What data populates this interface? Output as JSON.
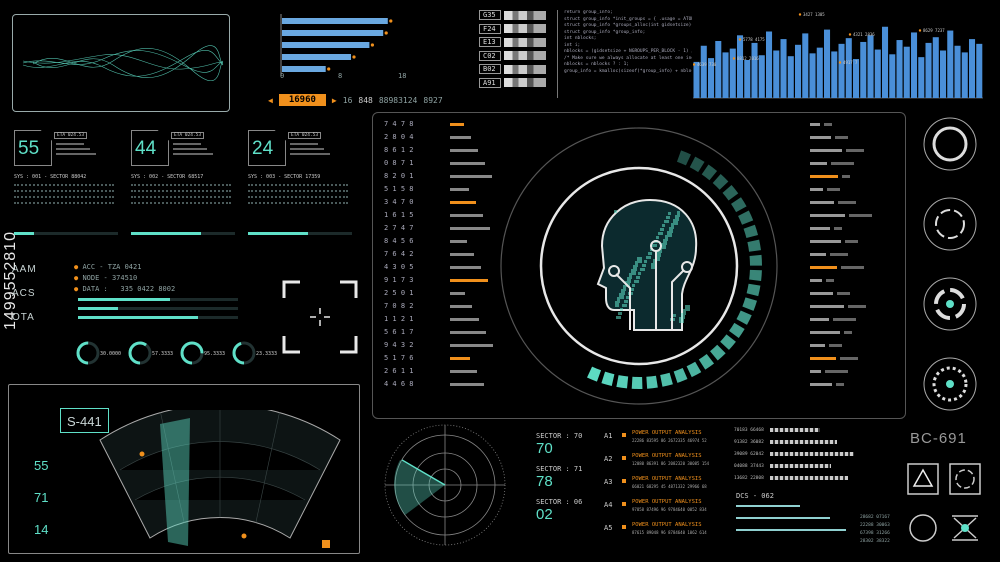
{
  "accent": "#5fe0c8",
  "orange": "#f0901c",
  "watermark": "1499552810",
  "top_counter": {
    "value": "16960",
    "rest": [
      "16",
      "848",
      "88983124",
      "8927"
    ]
  },
  "gauges": [
    {
      "value": "55",
      "tag": "ETA 024.53"
    },
    {
      "value": "44",
      "tag": "ETA 024.53"
    },
    {
      "value": "24",
      "tag": "ETA 024.53"
    }
  ],
  "sys_headers": [
    "SYS : 001 - SECTOR 88042",
    "SYS : 002 - SECTOR 68517",
    "SYS : 003 - SECTOR 17359"
  ],
  "side_labels": [
    "AAM",
    "ACS",
    "OTA"
  ],
  "info_lines": [
    "ACC - TZA 0421",
    "NODE - 374510",
    "DATA :",
    "335 0422 8002"
  ],
  "ring_values": [
    "30.0000",
    "57.3333",
    "95.3333",
    "23.3333"
  ],
  "radar_label": "S-441",
  "radar_side_numbers": [
    "55",
    "71",
    "14"
  ],
  "hbar_chart": {
    "values": [
      92,
      88,
      76,
      60,
      38
    ],
    "axis": [
      "0",
      "8",
      "18"
    ]
  },
  "code_tags": [
    "G35",
    "F24",
    "E13",
    "C02",
    "B02",
    "A91"
  ],
  "code_lines": [
    "return group_info;",
    "struct group_info *init_groups = { .usage = ATOMIC_INIT(2) };",
    "struct group_info *groups_alloc(int gidsetsize){",
    "  struct group_info *group_info;",
    "  int nblocks;",
    "  int i;",
    "nblocks = (gidsetsize + NGROUPS_PER_BLOCK - 1) / NGR",
    "/* Make sure we always allocate at least one indirect block",
    "nblocks = nblocks ? : 1;",
    "group_info = kmalloc(sizeof(*group_info) + nblocks*sizeof("
  ],
  "top_chart": {
    "values": [
      38,
      55,
      42,
      60,
      48,
      52,
      66,
      40,
      58,
      45,
      70,
      50,
      62,
      44,
      56,
      68,
      47,
      53,
      72,
      49,
      57,
      63,
      41,
      59,
      66,
      51,
      75,
      46,
      61,
      54,
      69,
      43,
      58,
      64,
      50,
      71,
      55,
      48,
      62,
      57
    ],
    "labels": [
      "3427 1305",
      "5778 4175",
      "4321 2836",
      "8629 7237",
      "4639 730",
      "8812 2016",
      "4917 7"
    ]
  },
  "sectors": [
    {
      "label": "SECTOR : 70",
      "value": "70"
    },
    {
      "label": "SECTOR : 71",
      "value": "78"
    },
    {
      "label": "SECTOR : 06",
      "value": "02"
    }
  ],
  "power_rows": [
    {
      "id": "A1",
      "title": "POWER OUTPUT ANALYSIS",
      "nums": "22286 83595 86 2672335 46974 52"
    },
    {
      "id": "A2",
      "title": "POWER OUTPUT ANALYSIS",
      "nums": "12080 86391 86 2082320 30085 154"
    },
    {
      "id": "A3",
      "title": "POWER OUTPUT ANALYSIS",
      "nums": "66021 68295 45 4871332 29966 68"
    },
    {
      "id": "A4",
      "title": "POWER OUTPUT ANALYSIS",
      "nums": "97858 87496 96 9784640 0052 834"
    },
    {
      "id": "A5",
      "title": "POWER OUTPUT ANALYSIS",
      "nums": "87615 89048 96 8784640 1062 614"
    }
  ],
  "right_code": "BC-691",
  "dcs_label": "DCS - 062",
  "right_list": [
    "70183 66468",
    "91382 36082",
    "39089 62042",
    "04088 37443",
    "13682 22808"
  ],
  "bottom_right_list": [
    "28682 07167",
    "22288 30063",
    "67398 31266",
    "28302 38322"
  ]
}
